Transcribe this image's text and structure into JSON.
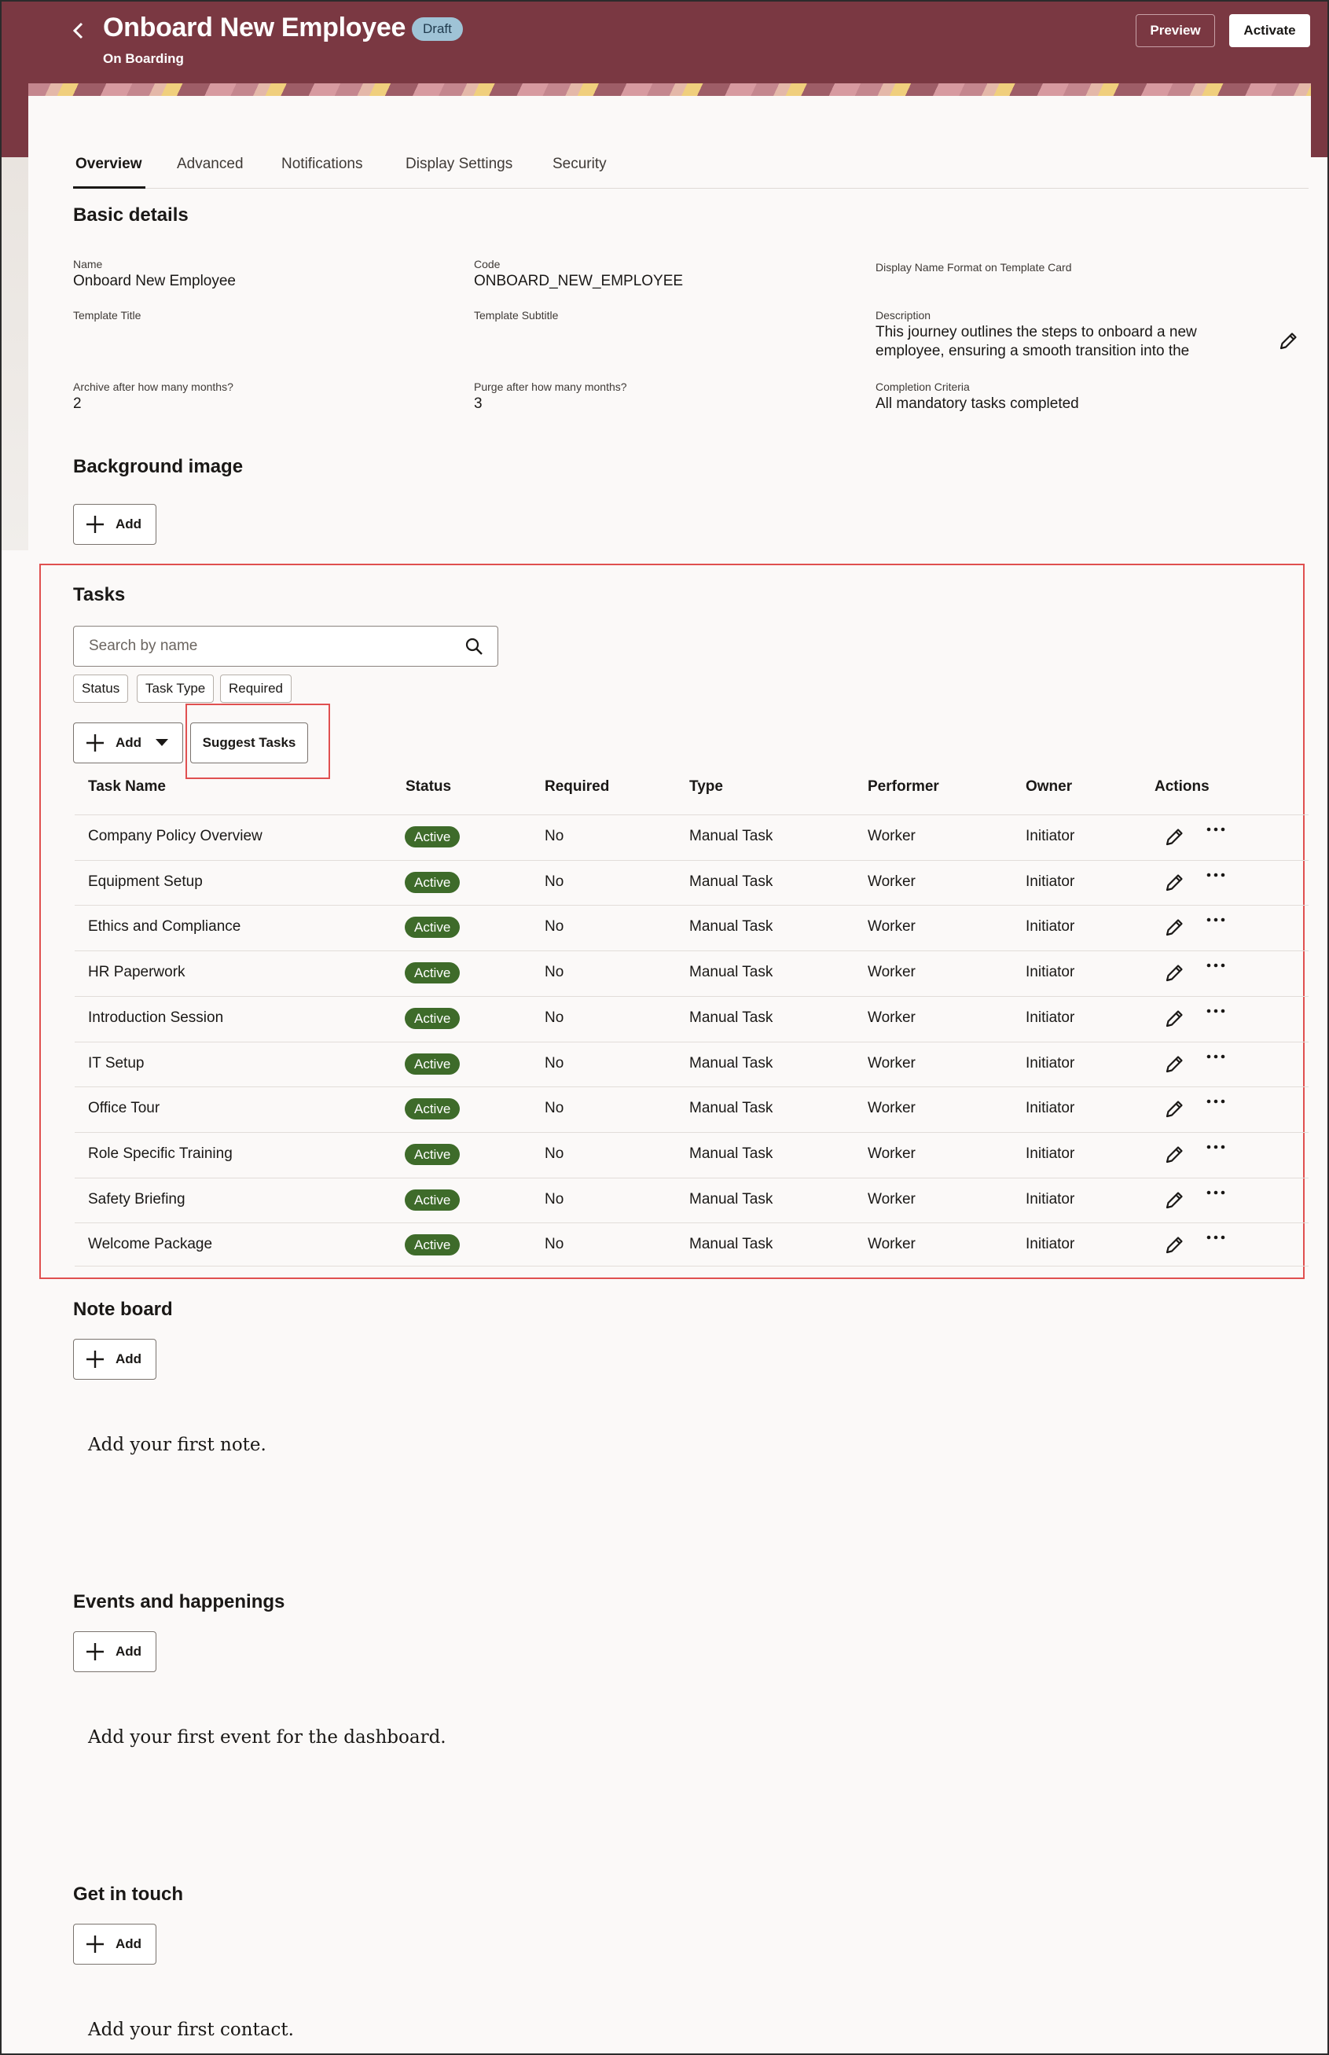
{
  "header": {
    "title": "Onboard New Employee",
    "badge": "Draft",
    "subtitle": "On Boarding",
    "preview_label": "Preview",
    "activate_label": "Activate"
  },
  "tabs": [
    {
      "label": "Overview",
      "active": true
    },
    {
      "label": "Advanced"
    },
    {
      "label": "Notifications"
    },
    {
      "label": "Display Settings"
    },
    {
      "label": "Security"
    }
  ],
  "basic_details": {
    "heading": "Basic details",
    "name_label": "Name",
    "name_value": "Onboard New Employee",
    "code_label": "Code",
    "code_value": "ONBOARD_NEW_EMPLOYEE",
    "display_name_label": "Display Name Format on Template Card",
    "template_title_label": "Template Title",
    "template_subtitle_label": "Template Subtitle",
    "description_label": "Description",
    "description_line1": "This journey outlines the steps to onboard a new",
    "description_line2": "employee, ensuring a smooth transition into the",
    "archive_label": "Archive after how many months?",
    "archive_value": "2",
    "purge_label": "Purge after how many months?",
    "purge_value": "3",
    "completion_label": "Completion Criteria",
    "completion_value": "All mandatory tasks completed"
  },
  "background_image": {
    "heading": "Background image",
    "add_label": "Add"
  },
  "tasks": {
    "heading": "Tasks",
    "search_placeholder": "Search by name",
    "filters": [
      "Status",
      "Task Type",
      "Required"
    ],
    "add_label": "Add",
    "suggest_label": "Suggest Tasks",
    "columns": [
      "Task Name",
      "Status",
      "Required",
      "Type",
      "Performer",
      "Owner",
      "Actions"
    ],
    "rows": [
      {
        "name": "Company Policy Overview",
        "status": "Active",
        "required": "No",
        "type": "Manual Task",
        "performer": "Worker",
        "owner": "Initiator"
      },
      {
        "name": "Equipment Setup",
        "status": "Active",
        "required": "No",
        "type": "Manual Task",
        "performer": "Worker",
        "owner": "Initiator"
      },
      {
        "name": "Ethics and Compliance",
        "status": "Active",
        "required": "No",
        "type": "Manual Task",
        "performer": "Worker",
        "owner": "Initiator"
      },
      {
        "name": "HR Paperwork",
        "status": "Active",
        "required": "No",
        "type": "Manual Task",
        "performer": "Worker",
        "owner": "Initiator"
      },
      {
        "name": "Introduction Session",
        "status": "Active",
        "required": "No",
        "type": "Manual Task",
        "performer": "Worker",
        "owner": "Initiator"
      },
      {
        "name": "IT Setup",
        "status": "Active",
        "required": "No",
        "type": "Manual Task",
        "performer": "Worker",
        "owner": "Initiator"
      },
      {
        "name": "Office Tour",
        "status": "Active",
        "required": "No",
        "type": "Manual Task",
        "performer": "Worker",
        "owner": "Initiator"
      },
      {
        "name": "Role Specific Training",
        "status": "Active",
        "required": "No",
        "type": "Manual Task",
        "performer": "Worker",
        "owner": "Initiator"
      },
      {
        "name": "Safety Briefing",
        "status": "Active",
        "required": "No",
        "type": "Manual Task",
        "performer": "Worker",
        "owner": "Initiator"
      },
      {
        "name": "Welcome Package",
        "status": "Active",
        "required": "No",
        "type": "Manual Task",
        "performer": "Worker",
        "owner": "Initiator"
      }
    ]
  },
  "note_board": {
    "heading": "Note board",
    "add_label": "Add",
    "empty": "Add your first note."
  },
  "events": {
    "heading": "Events and happenings",
    "add_label": "Add",
    "empty": "Add your first event for the dashboard."
  },
  "contact": {
    "heading": "Get in touch",
    "add_label": "Add",
    "empty": "Add your first contact."
  },
  "colors": {
    "brand": "#7a3842",
    "status_active": "#3e6b2a",
    "highlight": "#e05050",
    "badge": "#9fc3d6"
  },
  "icons": [
    "chevron-left-icon",
    "plus-icon",
    "search-icon",
    "pencil-icon",
    "more-icon",
    "caret-down-icon"
  ]
}
